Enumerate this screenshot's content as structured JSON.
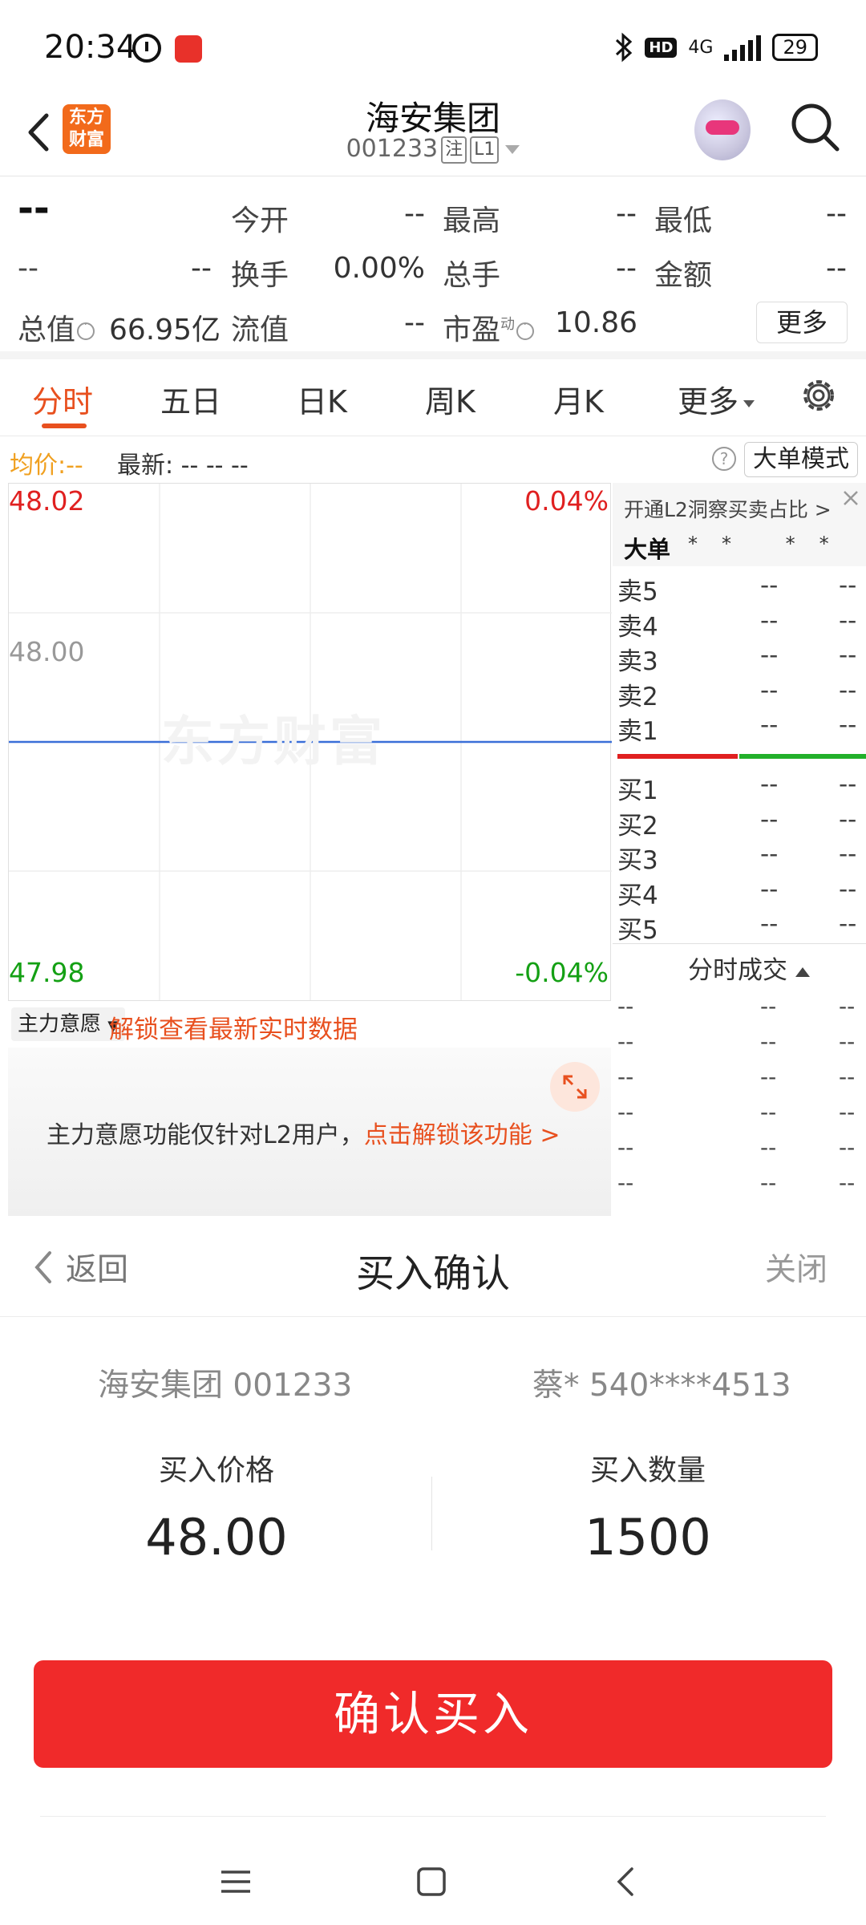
{
  "status_bar": {
    "time": "20:34",
    "battery": "29",
    "network": "4G",
    "hd": "HD"
  },
  "header": {
    "stock_name": "海安集团",
    "stock_code": "001233",
    "tag1": "注",
    "tag2": "L1",
    "logo_line1": "东方",
    "logo_line2": "财富"
  },
  "quote": {
    "price": "--",
    "change1": "--",
    "change2": "--",
    "open_label": "今开",
    "open": "--",
    "high_label": "最高",
    "high": "--",
    "low_label": "最低",
    "low": "--",
    "turnover_label": "换手",
    "turnover": "0.00%",
    "volume_label": "总手",
    "volume": "--",
    "amount_label": "金额",
    "amount": "--",
    "mktcap_label": "总值",
    "mktcap": "66.95亿",
    "float_label": "流值",
    "float": "--",
    "pe_label": "市盈",
    "pe_sup": "动",
    "pe": "10.86",
    "more": "更多"
  },
  "tabs": [
    {
      "label": "分时"
    },
    {
      "label": "五日"
    },
    {
      "label": "日K"
    },
    {
      "label": "周K"
    },
    {
      "label": "月K"
    },
    {
      "label": "更多"
    }
  ],
  "avg_bar": {
    "avg_label": "均价:",
    "avg_value": "--",
    "latest_label": "最新:",
    "latest_values": "--  --  --",
    "big_order_mode": "大单模式"
  },
  "chart": {
    "top_price": "48.02",
    "top_pct": "0.04%",
    "mid_price": "48.00",
    "bottom_price": "47.98",
    "bottom_pct": "-0.04%",
    "watermark": "东方财富"
  },
  "chart_data": {
    "type": "line",
    "ylim": [
      47.98,
      48.02
    ],
    "series": [
      {
        "values": [
          48.0,
          48.0
        ]
      }
    ],
    "y_ticks": [
      "48.02",
      "48.00",
      "47.98"
    ],
    "pct_ticks": [
      "0.04%",
      "-0.04%"
    ],
    "grid": true
  },
  "main_force": {
    "select": "主力意愿",
    "unlock": "解锁查看最新实时数据"
  },
  "promo": {
    "text": "主力意愿功能仅针对L2用户，",
    "link": "点击解锁该功能 >"
  },
  "order_book": {
    "l2_link": "开通L2洞察买卖占比 >",
    "big_order": "大单",
    "big_stars": "** **",
    "asks": [
      {
        "label": "卖5",
        "price": "--",
        "vol": "--"
      },
      {
        "label": "卖4",
        "price": "--",
        "vol": "--"
      },
      {
        "label": "卖3",
        "price": "--",
        "vol": "--"
      },
      {
        "label": "卖2",
        "price": "--",
        "vol": "--"
      },
      {
        "label": "卖1",
        "price": "--",
        "vol": "--"
      }
    ],
    "bids": [
      {
        "label": "买1",
        "price": "--",
        "vol": "--"
      },
      {
        "label": "买2",
        "price": "--",
        "vol": "--"
      },
      {
        "label": "买3",
        "price": "--",
        "vol": "--"
      },
      {
        "label": "买4",
        "price": "--",
        "vol": "--"
      },
      {
        "label": "买5",
        "price": "--",
        "vol": "--"
      }
    ],
    "tick_title": "分时成交",
    "ticks": [
      [
        "--",
        "--",
        "--"
      ],
      [
        "--",
        "--",
        "--"
      ],
      [
        "--",
        "--",
        "--"
      ],
      [
        "--",
        "--",
        "--"
      ],
      [
        "--",
        "--",
        "--"
      ],
      [
        "--",
        "--",
        "--"
      ],
      [
        "--",
        "--",
        "--"
      ]
    ]
  },
  "sheet": {
    "back": "返回",
    "title": "买入确认",
    "close": "关闭",
    "account_stock": "海安集团 001233",
    "account_holder": "蔡* 540****4513",
    "price_label": "买入价格",
    "price_value": "48.00",
    "qty_label": "买入数量",
    "qty_value": "1500",
    "confirm": "确认买入"
  },
  "colors": {
    "accent": "#e8501f",
    "up": "#e02020",
    "down": "#14a014",
    "confirm": "#f02a2a"
  }
}
